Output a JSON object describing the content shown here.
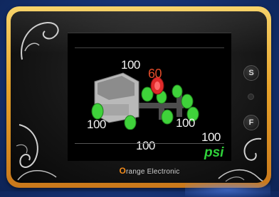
{
  "display": {
    "pressures": {
      "top": "100",
      "alert": "60",
      "left_mid": "100",
      "right_mid": "100",
      "right_low": "100",
      "bottom": "100"
    },
    "unit": "psi",
    "brand_initial": "O",
    "brand_rest": "range Electronic"
  },
  "buttons": {
    "set_label": "S",
    "function_label": "F"
  },
  "icons": {
    "truck": "truck-tire-layout-icon",
    "swirl": "decorative-swirl-icon"
  },
  "colors": {
    "bezel": "#e8a32a",
    "normal_tire": "#3fd23a",
    "alert_tire": "#e02a2a",
    "alert_text": "#e04b2a",
    "unit_text": "#2fd23a",
    "brand_accent": "#f08a1b"
  }
}
